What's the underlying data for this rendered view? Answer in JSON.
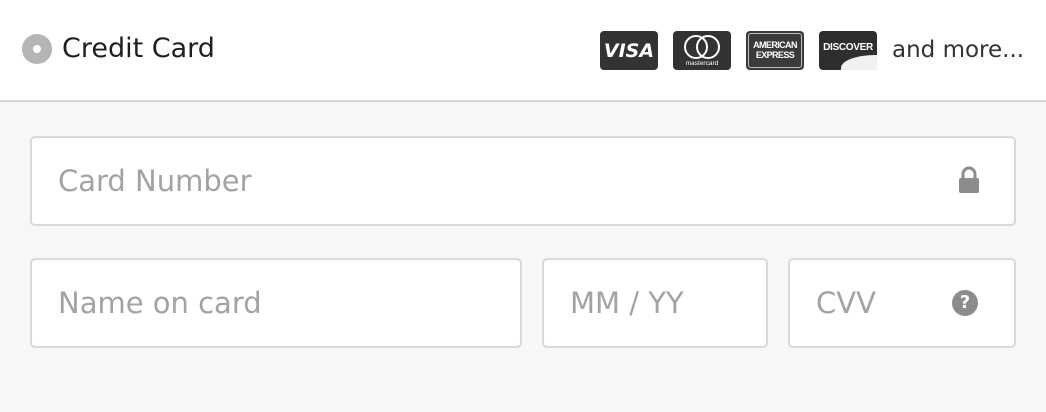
{
  "payment_method": {
    "label": "Credit Card",
    "selected": true,
    "brands": [
      {
        "name": "visa-logo",
        "text": "VISA"
      },
      {
        "name": "mastercard-logo",
        "text": "mastercard"
      },
      {
        "name": "american-express-logo",
        "line1": "AMERICAN",
        "line2": "EXPRESS"
      },
      {
        "name": "discover-logo",
        "text": "DISCOVER"
      }
    ],
    "more_text": "and more..."
  },
  "form": {
    "card_number": {
      "placeholder": "Card Number",
      "icon": "lock-icon"
    },
    "name_on_card": {
      "placeholder": "Name on card"
    },
    "expiry": {
      "placeholder": "MM / YY"
    },
    "cvv": {
      "placeholder": "CVV",
      "icon": "help-icon",
      "help_glyph": "?"
    }
  },
  "colors": {
    "header_bg": "#ffffff",
    "form_bg": "#f7f7f7",
    "field_border": "#d9d9d9",
    "placeholder": "#a3a3a3",
    "brand_logo_bg": "#333333"
  }
}
